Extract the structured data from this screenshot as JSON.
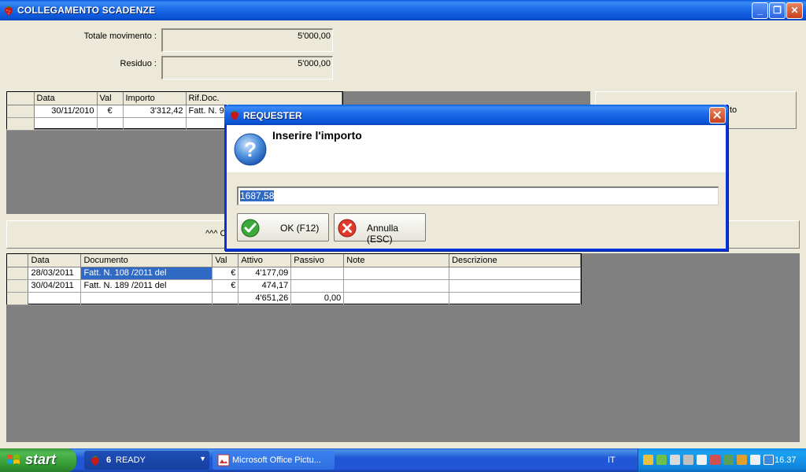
{
  "window": {
    "title": "COLLEGAMENTO SCADENZE",
    "minimize": "_",
    "maximize": "❐",
    "close": "✕"
  },
  "summary": {
    "totale_label": "Totale movimento :",
    "totale_value": "5'000,00",
    "residuo_label": "Residuo :",
    "residuo_value": "5'000,00"
  },
  "top_grid": {
    "headers": [
      "Data",
      "Val",
      "Importo",
      "Rif.Doc."
    ],
    "rows": [
      {
        "data": "30/11/2010",
        "val": "€",
        "importo": "3'312,42",
        "rif": "Fatt. N. 9("
      }
    ]
  },
  "right_panel_fragment": "to",
  "middle_bar_fragment": "^^^ C",
  "bottom_grid": {
    "headers": [
      "Data",
      "Documento",
      "Val",
      "Attivo",
      "Passivo",
      "Note",
      "Descrizione"
    ],
    "rows": [
      {
        "data": "28/03/2011",
        "documento": "Fatt. N. 108 /2011 del",
        "val": "€",
        "attivo": "4'177,09",
        "passivo": "",
        "note": "",
        "descrizione": ""
      },
      {
        "data": "30/04/2011",
        "documento": "Fatt. N. 189 /2011 del",
        "val": "€",
        "attivo": "474,17",
        "passivo": "",
        "note": "",
        "descrizione": ""
      }
    ],
    "totals": {
      "attivo": "4'651,26",
      "passivo": "0,00"
    }
  },
  "dialog": {
    "title": "REQUESTER",
    "message": "Inserire l'importo",
    "input_value": "1687,58",
    "ok_label": "OK (F12)",
    "cancel_label": "Annulla (ESC)",
    "icon": "question-icon"
  },
  "taskbar": {
    "start_label": "start",
    "tasks": [
      {
        "label": "READY",
        "count": "6"
      },
      {
        "label": "Microsoft Office Pictu..."
      }
    ],
    "language": "IT",
    "clock": "16.37"
  },
  "colors": {
    "title_blue": "#0a5ae0",
    "selection": "#316ac5",
    "grid_grey": "#808080",
    "start_green": "#3c9a3c"
  }
}
